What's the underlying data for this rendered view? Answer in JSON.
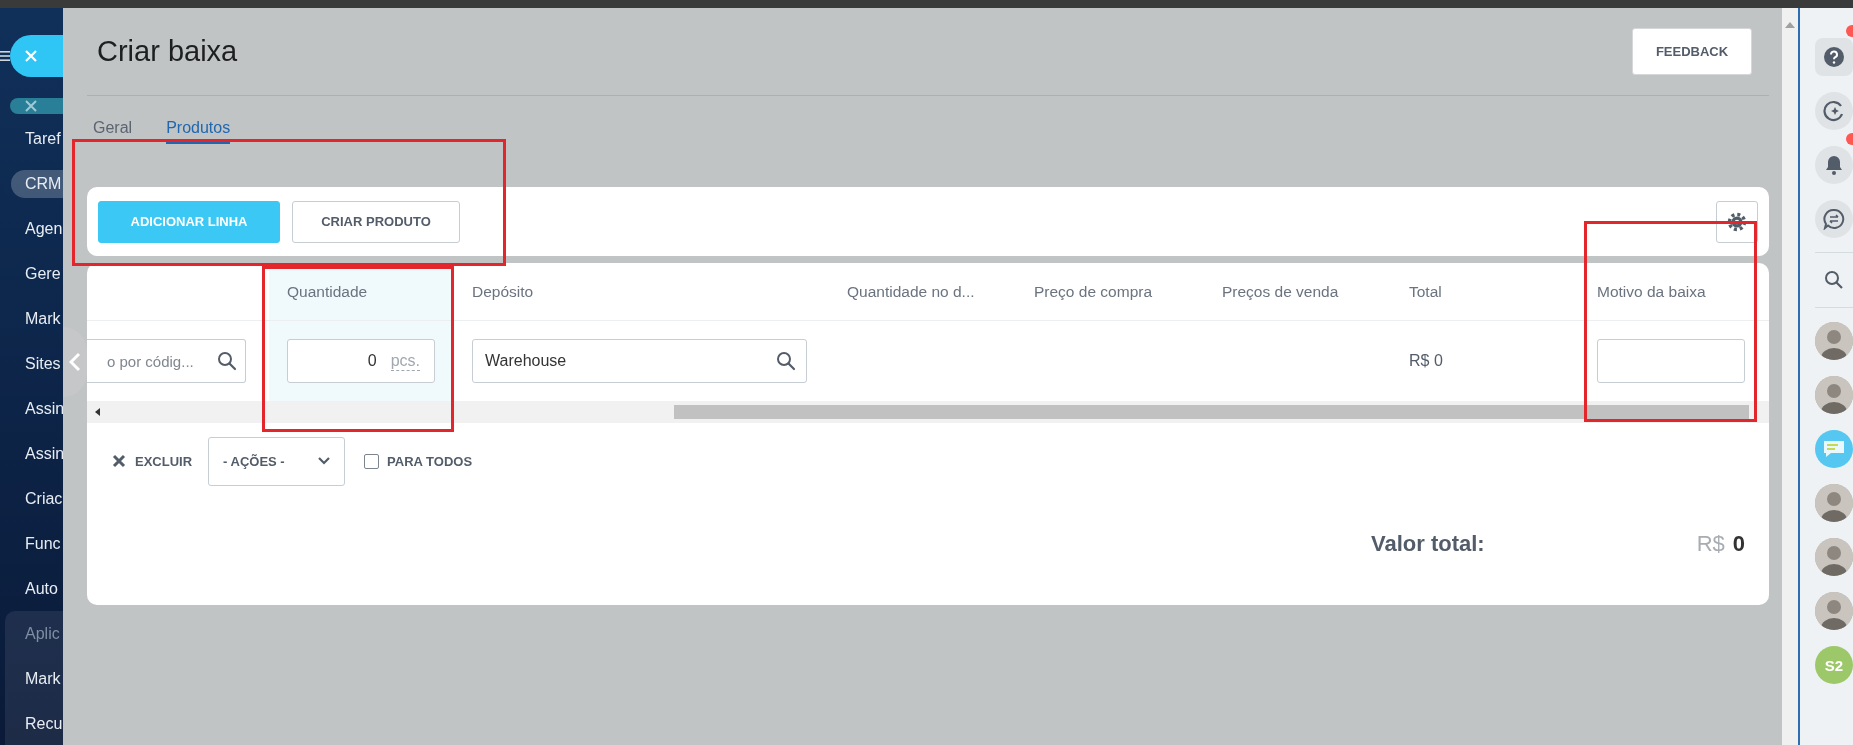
{
  "sidebar": {
    "items": [
      {
        "label": "Taref",
        "selected": false
      },
      {
        "label": "CRM",
        "selected": true
      },
      {
        "label": "Agen",
        "selected": false
      },
      {
        "label": "Gere",
        "selected": false
      },
      {
        "label": "Mark",
        "selected": false
      },
      {
        "label": "Sites",
        "selected": false
      },
      {
        "label": "Assin",
        "selected": false
      },
      {
        "label": "Assin",
        "selected": false
      },
      {
        "label": "Criac",
        "selected": false
      },
      {
        "label": "Func",
        "selected": false
      },
      {
        "label": "Auto",
        "selected": false
      }
    ],
    "group": {
      "title": "Aplic",
      "items": [
        "Mark",
        "Recu"
      ]
    }
  },
  "panel": {
    "title": "Criar baixa",
    "feedback_button": "FEEDBACK",
    "tabs": [
      {
        "label": "Geral",
        "selected": false
      },
      {
        "label": "Produtos",
        "selected": true
      }
    ],
    "toolbar": {
      "buttons": [
        {
          "label": "ADICIONAR LINHA",
          "kind": "primary"
        },
        {
          "label": "CRIAR PRODUTO",
          "kind": "secondary"
        }
      ]
    },
    "table": {
      "columns": [
        "Quantidade",
        "Depósito",
        "Quantidade no d...",
        "Preço de compra",
        "Preços de venda",
        "Total",
        "Motivo da baixa"
      ],
      "row": {
        "product_search": {
          "placeholder": "o por códig..."
        },
        "quantity": "0",
        "unit": "pcs.",
        "warehouse": "Warehouse",
        "total": "R$ 0"
      }
    },
    "footer": {
      "delete": "EXCLUIR",
      "actions": "- AÇÕES -",
      "for_all": {
        "label": "PARA TODOS",
        "checked": false
      }
    },
    "summary": {
      "label": "Valor total:",
      "currency": "R$",
      "amount": "0"
    }
  },
  "right_bar": {
    "items": [
      {
        "kind": "help",
        "badge": true
      },
      {
        "kind": "copilot"
      },
      {
        "kind": "bell",
        "badge": true
      },
      {
        "kind": "chat"
      },
      {
        "kind": "search"
      },
      {
        "kind": "avatar"
      },
      {
        "kind": "avatar"
      },
      {
        "kind": "chat-avatar"
      },
      {
        "kind": "avatar"
      },
      {
        "kind": "avatar"
      },
      {
        "kind": "avatar"
      },
      {
        "kind": "initials",
        "label": "S2"
      }
    ]
  }
}
